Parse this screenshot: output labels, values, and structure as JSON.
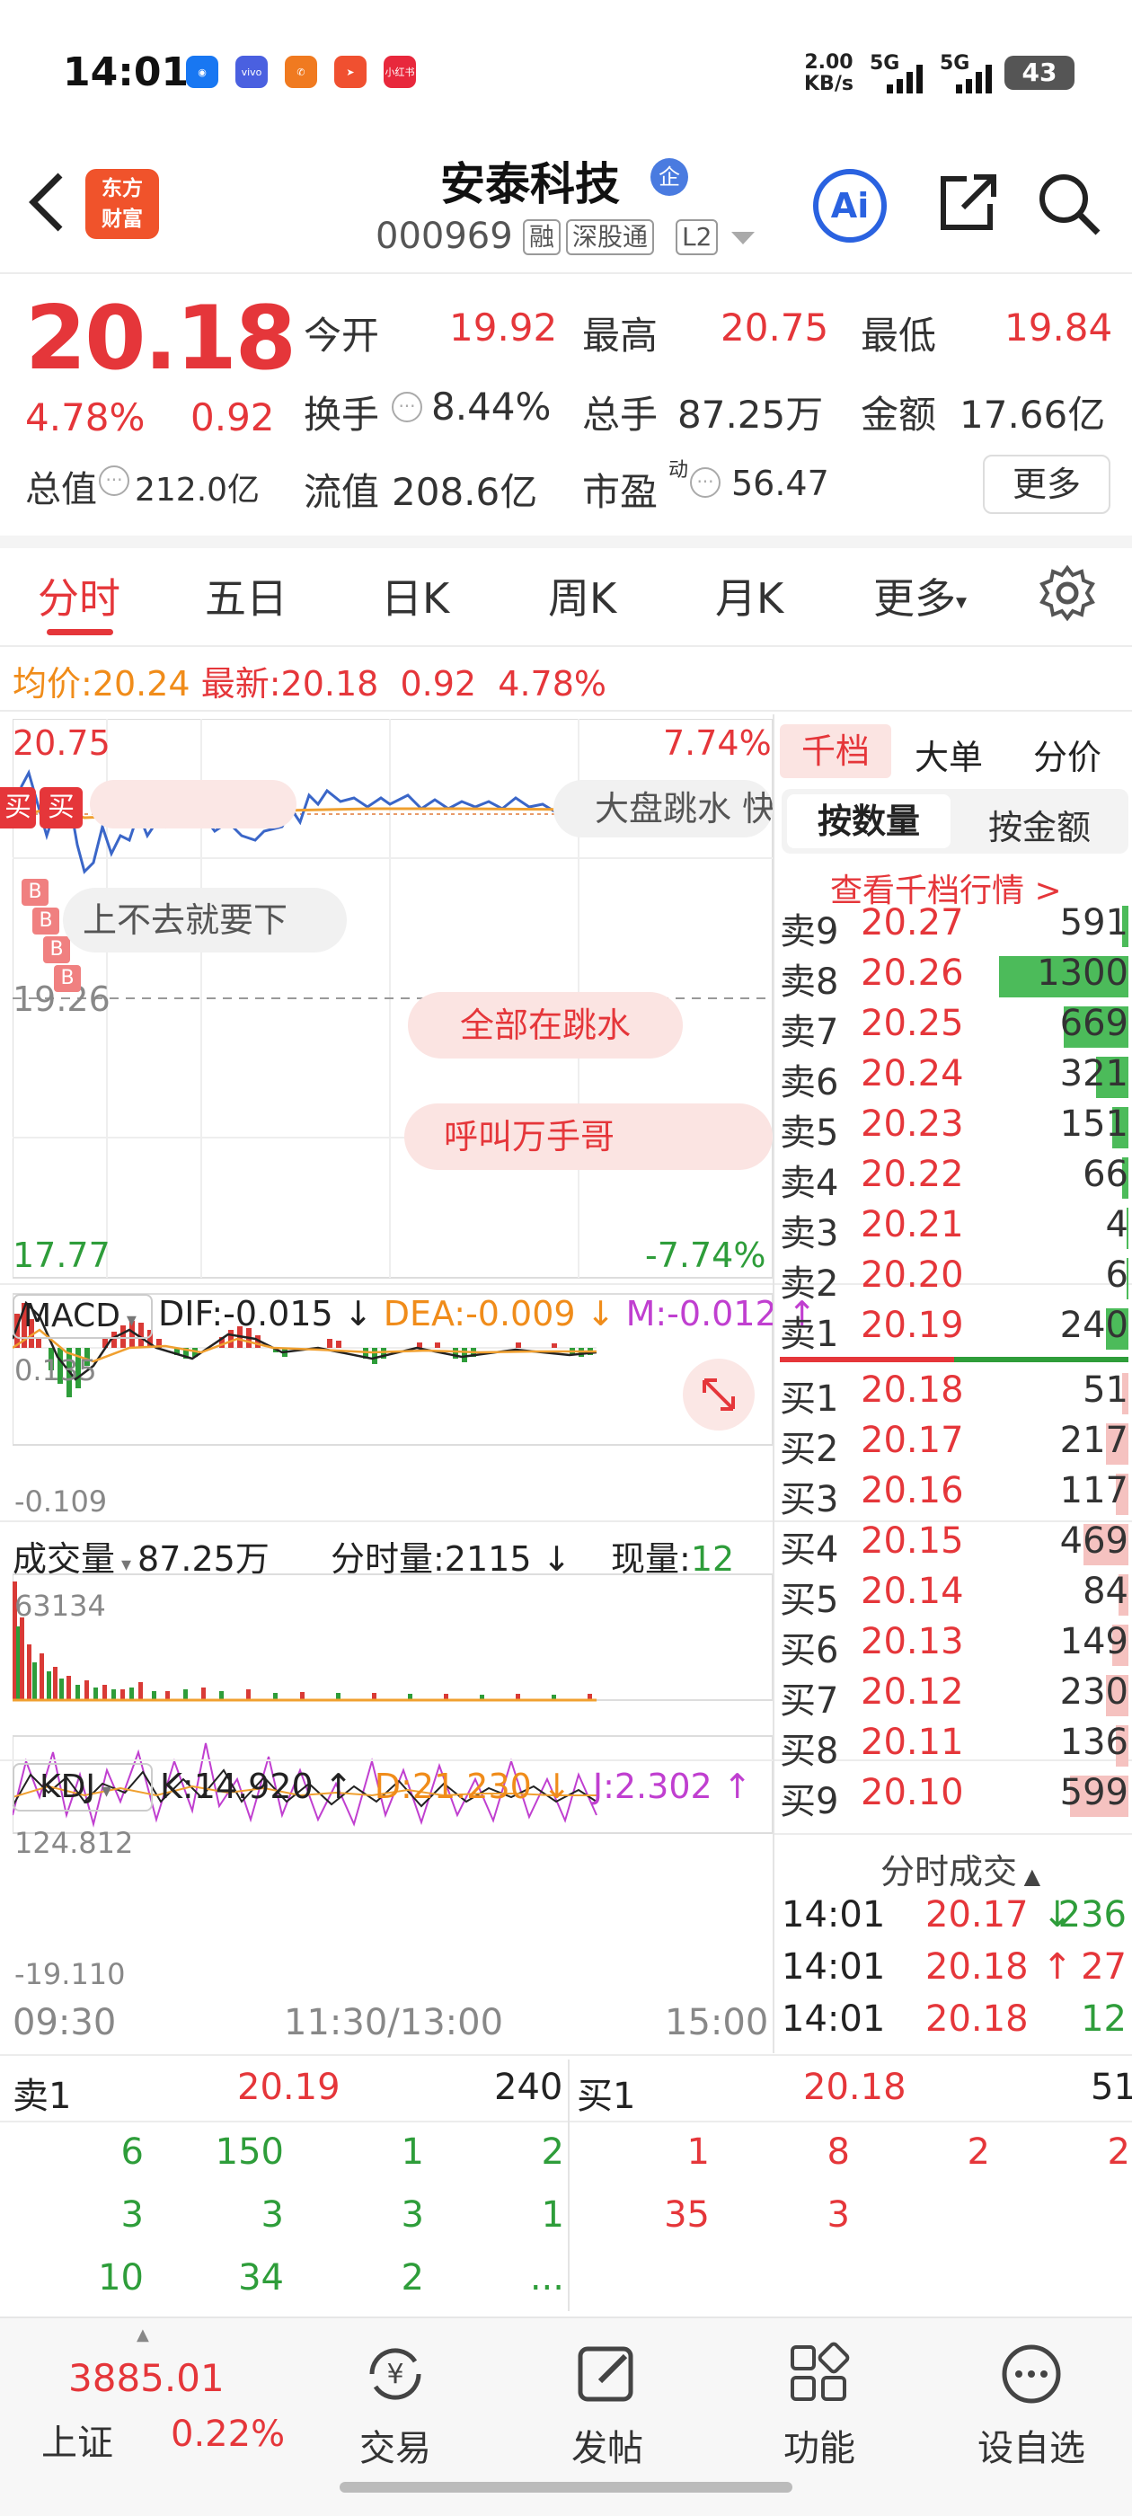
{
  "status_bar": {
    "time": "14:01",
    "speed": "2.00",
    "speed_unit": "KB/s",
    "signal1": "5G",
    "signal2": "5G",
    "battery": "43",
    "app_icon_label": "小红书"
  },
  "header": {
    "logo_line1": "东方",
    "logo_line2": "财富",
    "title": "安泰科技",
    "title_badge": "企",
    "code": "000969",
    "tags": [
      "融",
      "深股通",
      "L2"
    ],
    "ai_label": "Ai"
  },
  "quote": {
    "price": "20.18",
    "pct": "4.78%",
    "chg": "0.92",
    "open_label": "今开",
    "open": "19.92",
    "high_label": "最高",
    "high": "20.75",
    "low_label": "最低",
    "low": "19.84",
    "turnover_label": "换手",
    "turnover": "8.44%",
    "vol_label": "总手",
    "vol": "87.25万",
    "amt_label": "金额",
    "amt": "17.66亿",
    "mktcap_label": "总值",
    "mktcap": "212.0亿",
    "float_label": "流值",
    "float": "208.6亿",
    "pe_label": "市盈",
    "pe_sup": "动",
    "pe": "56.47",
    "more": "更多"
  },
  "tabs": [
    {
      "label": "分时"
    },
    {
      "label": "五日"
    },
    {
      "label": "日K"
    },
    {
      "label": "周K"
    },
    {
      "label": "月K"
    },
    {
      "label": "更多"
    }
  ],
  "infoline": {
    "avg_label": "均价:",
    "avg": "20.24",
    "latest_label": "最新:",
    "latest": "20.18",
    "chg": "0.92",
    "pct": "4.78%"
  },
  "chart": {
    "y_high": "20.75",
    "y_mid": "19.26",
    "y_low": "17.77",
    "pct_high": "7.74%",
    "pct_low": "-7.74%",
    "buy_tags": [
      "买",
      "买"
    ],
    "b_markers": [
      "B",
      "B",
      "B",
      "B"
    ],
    "bubbles": [
      "大盘跳水",
      "上不去就要下",
      "全部在跳水",
      "呼叫万手哥"
    ],
    "bubble_cut": "快",
    "macd": {
      "name": "MACD",
      "dif": "DIF:-0.015",
      "dea": "DEA:-0.009",
      "m": "M:-0.012",
      "top": "0.135",
      "bottom": "-0.109"
    },
    "vol": {
      "name": "成交量",
      "total": "87.25万",
      "ft_label": "分时量:2115",
      "now_label": "现量:",
      "now": "12",
      "top": "63134"
    },
    "kdj": {
      "name": "KDJ",
      "k": "K:14.920",
      "d": "D:21.230",
      "j": "J:2.302",
      "top": "124.812",
      "bottom": "-19.110"
    },
    "times": [
      "09:30",
      "11:30/13:00",
      "15:00"
    ]
  },
  "orderbook": {
    "tabs": [
      "千档",
      "大单",
      "分价"
    ],
    "sub_tabs": [
      "按数量",
      "按金额"
    ],
    "link": "查看千档行情 >",
    "sell": [
      {
        "label": "卖9",
        "price": "20.27",
        "vol": "591",
        "frac": 0.02
      },
      {
        "label": "卖8",
        "price": "20.26",
        "vol": "1300",
        "frac": 0.4
      },
      {
        "label": "卖7",
        "price": "20.25",
        "vol": "669",
        "frac": 0.2
      },
      {
        "label": "卖6",
        "price": "20.24",
        "vol": "321",
        "frac": 0.1
      },
      {
        "label": "卖5",
        "price": "20.23",
        "vol": "151",
        "frac": 0.05
      },
      {
        "label": "卖4",
        "price": "20.22",
        "vol": "66",
        "frac": 0.02
      },
      {
        "label": "卖3",
        "price": "20.21",
        "vol": "4",
        "frac": 0.0
      },
      {
        "label": "卖2",
        "price": "20.20",
        "vol": "6",
        "frac": 0.0
      },
      {
        "label": "卖1",
        "price": "20.19",
        "vol": "240",
        "frac": 0.07
      }
    ],
    "buy": [
      {
        "label": "买1",
        "price": "20.18",
        "vol": "51",
        "frac": 0.02
      },
      {
        "label": "买2",
        "price": "20.17",
        "vol": "217",
        "frac": 0.07
      },
      {
        "label": "买3",
        "price": "20.16",
        "vol": "117",
        "frac": 0.04
      },
      {
        "label": "买4",
        "price": "20.15",
        "vol": "469",
        "frac": 0.14
      },
      {
        "label": "买5",
        "price": "20.14",
        "vol": "84",
        "frac": 0.03
      },
      {
        "label": "买6",
        "price": "20.13",
        "vol": "149",
        "frac": 0.05
      },
      {
        "label": "买7",
        "price": "20.12",
        "vol": "230",
        "frac": 0.07
      },
      {
        "label": "买8",
        "price": "20.11",
        "vol": "136",
        "frac": 0.04
      },
      {
        "label": "买9",
        "price": "20.10",
        "vol": "599",
        "frac": 0.18
      }
    ],
    "trades_title": "分时成交",
    "trades": [
      {
        "time": "14:01",
        "price": "20.17",
        "dir": "↓",
        "vol": "236"
      },
      {
        "time": "14:01",
        "price": "20.18",
        "dir": "↑",
        "vol": "27"
      },
      {
        "time": "14:01",
        "price": "20.18",
        "dir": "",
        "vol": "12"
      }
    ]
  },
  "bottom_book": {
    "left_label": "卖1",
    "left_price": "20.19",
    "left_vol": "240",
    "right_label": "买1",
    "right_price": "20.18",
    "right_vol": "51",
    "left_rows": [
      [
        "6",
        "150",
        "1",
        "2"
      ],
      [
        "3",
        "3",
        "3",
        "1"
      ],
      [
        "10",
        "34",
        "2",
        "..."
      ]
    ],
    "right_rows": [
      [
        "1",
        "8",
        "2",
        "2"
      ],
      [
        "35",
        "3",
        "",
        ""
      ]
    ]
  },
  "bottom_nav": {
    "index_value": "3885.01",
    "index_name": "上证",
    "index_pct": "0.22%",
    "items": [
      "交易",
      "发帖",
      "功能",
      "设自选"
    ]
  }
}
